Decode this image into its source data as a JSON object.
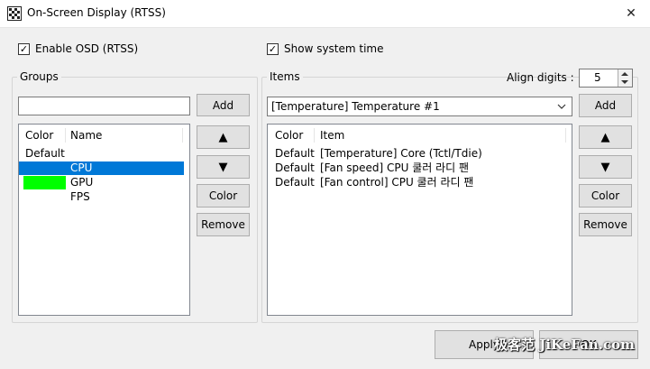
{
  "window": {
    "title": "On-Screen Display (RTSS)",
    "close_glyph": "✕"
  },
  "options": {
    "enable_osd_label": "Enable OSD (RTSS)",
    "enable_osd_checked": true,
    "show_time_label": "Show system time",
    "show_time_checked": true
  },
  "groups": {
    "label": "Groups",
    "name_value": "",
    "add_label": "Add",
    "up_label": "▲",
    "down_label": "▼",
    "color_label": "Color",
    "remove_label": "Remove",
    "columns": [
      "Color",
      "Name"
    ],
    "rows": [
      {
        "color_text": "Default",
        "swatch": "",
        "name": "",
        "selected": false
      },
      {
        "color_text": "",
        "swatch": "",
        "name": "CPU",
        "selected": true
      },
      {
        "color_text": "",
        "swatch": "#00ff00",
        "name": "GPU",
        "selected": false
      },
      {
        "color_text": "",
        "swatch": "",
        "name": "FPS",
        "selected": false
      }
    ]
  },
  "items": {
    "label": "Items",
    "align_label": "Align digits :",
    "align_value": "5",
    "combo_value": "[Temperature] Temperature #1",
    "add_label": "Add",
    "up_label": "▲",
    "down_label": "▼",
    "color_label": "Color",
    "remove_label": "Remove",
    "columns": [
      "Color",
      "Item"
    ],
    "rows": [
      {
        "color_text": "Default",
        "item": "[Temperature] Core (Tctl/Tdie)"
      },
      {
        "color_text": "Default",
        "item": "[Fan speed] CPU 쿨러 라디 팬"
      },
      {
        "color_text": "Default",
        "item": "[Fan control] CPU 쿨러 라디 팬"
      }
    ]
  },
  "footer": {
    "apply_label": "Apply",
    "ok_label": "OK"
  },
  "watermark": "极客范 JiKeFan.com",
  "colors": {
    "selection": "#0078d7",
    "green": "#00ff00"
  }
}
